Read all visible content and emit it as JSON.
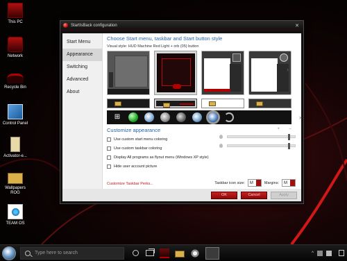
{
  "desktop": {
    "icons": [
      {
        "label": "This PC"
      },
      {
        "label": "Network"
      },
      {
        "label": "Recycle Bin"
      },
      {
        "label": "Control Panel"
      },
      {
        "label": "Activator-e..."
      },
      {
        "label": "Wallpapers ROG"
      },
      {
        "label": "TEAM OS"
      }
    ]
  },
  "window": {
    "title": "StartIsBack configuration",
    "close_glyph": "✕",
    "nav": [
      {
        "label": "Start Menu",
        "active": false
      },
      {
        "label": "Appearance",
        "active": true
      },
      {
        "label": "Switching",
        "active": false
      },
      {
        "label": "Advanced",
        "active": false
      },
      {
        "label": "About",
        "active": false
      }
    ],
    "heading": "Choose Start menu, taskbar and Start button style",
    "visual_style": "Visual style:  HUD Machine Red Light + orb (05) button",
    "customize_heading": "Customize appearance",
    "options": [
      {
        "label": "Use custom start menu coloring"
      },
      {
        "label": "Use custom taskbar coloring"
      },
      {
        "label": "Display All programs as flyout menu (Windows XP style)"
      },
      {
        "label": "Hide user account picture"
      }
    ],
    "sliders": [
      0.9,
      0.9
    ],
    "perks_link": "Customize Taskbar Perks...",
    "taskbar_icon_size_label": "Taskbar icon size:",
    "taskbar_icon_size_value": "M",
    "margins_label": "Margins:",
    "margins_value": "M",
    "buttons": {
      "ok": "OK",
      "cancel": "Cancel",
      "apply": "Apply"
    }
  },
  "taskbar": {
    "search_placeholder": "Type here to search",
    "clock_line1": "",
    "clock_line2": "",
    "accent": "#b00000"
  }
}
